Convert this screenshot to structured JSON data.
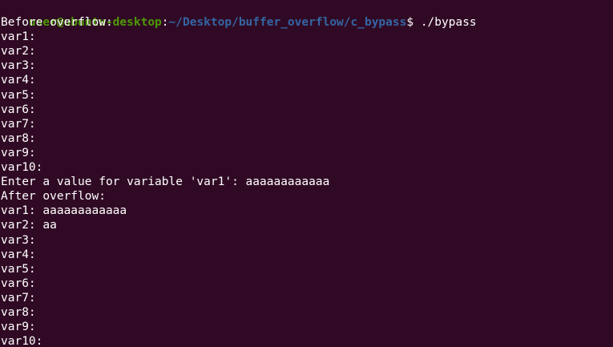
{
  "terminal": {
    "prompt": {
      "user_host": "user@ubuntu-desktop",
      "separator": ":",
      "path": "~/Desktop/buffer_overflow/c_bypass",
      "symbol": "$ ",
      "command": "./bypass"
    },
    "output_lines": [
      "Before overflow:",
      "var1:",
      "var2:",
      "var3:",
      "var4:",
      "var5:",
      "var6:",
      "var7:",
      "var8:",
      "var9:",
      "var10:",
      "Enter a value for variable 'var1': aaaaaaaaaaaa",
      "After overflow:",
      "var1: aaaaaaaaaaaa",
      "var2: aa",
      "var3:",
      "var4:",
      "var5:",
      "var6:",
      "var7:",
      "var8:",
      "var9:",
      "var10:"
    ],
    "colors": {
      "background": "#300a24",
      "text": "#ffffff",
      "user_host": "#4e9a06",
      "path": "#3465a4"
    }
  }
}
